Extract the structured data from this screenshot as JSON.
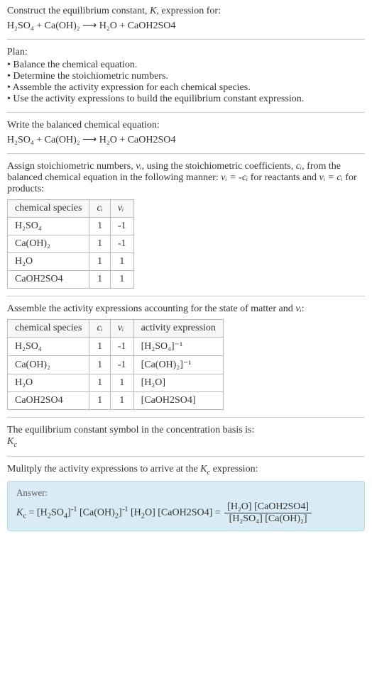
{
  "header": {
    "title_prefix": "Construct the equilibrium constant, ",
    "title_K": "K",
    "title_suffix": ", expression for:"
  },
  "eq1": "H₂SO₄ + Ca(OH)₂ ⟶ H₂O + CaOH2SO4",
  "plan": {
    "title": "Plan:",
    "items": [
      "Balance the chemical equation.",
      "Determine the stoichiometric numbers.",
      "Assemble the activity expression for each chemical species.",
      "Use the activity expressions to build the equilibrium constant expression."
    ]
  },
  "balanced": {
    "title": "Write the balanced chemical equation:",
    "eq": "H₂SO₄ + Ca(OH)₂ ⟶ H₂O + CaOH2SO4"
  },
  "assign": {
    "text_p1": "Assign stoichiometric numbers, ",
    "nu_i": "νᵢ",
    "text_p2": ", using the stoichiometric coefficients, ",
    "c_i": "cᵢ",
    "text_p3": ", from the balanced chemical equation in the following manner: ",
    "rel1": "νᵢ = -cᵢ",
    "text_p4": " for reactants and ",
    "rel2": "νᵢ = cᵢ",
    "text_p5": " for products:"
  },
  "table1": {
    "headers": [
      "chemical species",
      "cᵢ",
      "νᵢ"
    ],
    "rows": [
      {
        "species": "H₂SO₄",
        "c": "1",
        "nu": "-1"
      },
      {
        "species": "Ca(OH)₂",
        "c": "1",
        "nu": "-1"
      },
      {
        "species": "H₂O",
        "c": "1",
        "nu": "1"
      },
      {
        "species": "CaOH2SO4",
        "c": "1",
        "nu": "1"
      }
    ]
  },
  "assemble": {
    "text_p1": "Assemble the activity expressions accounting for the state of matter and ",
    "nu_i": "νᵢ",
    "text_p2": ":"
  },
  "table2": {
    "headers": [
      "chemical species",
      "cᵢ",
      "νᵢ",
      "activity expression"
    ],
    "rows": [
      {
        "species": "H₂SO₄",
        "c": "1",
        "nu": "-1",
        "act": "[H₂SO₄]⁻¹"
      },
      {
        "species": "Ca(OH)₂",
        "c": "1",
        "nu": "-1",
        "act": "[Ca(OH)₂]⁻¹"
      },
      {
        "species": "H₂O",
        "c": "1",
        "nu": "1",
        "act": "[H₂O]"
      },
      {
        "species": "CaOH2SO4",
        "c": "1",
        "nu": "1",
        "act": "[CaOH2SO4]"
      }
    ]
  },
  "kc_symbol": {
    "text": "The equilibrium constant symbol in the concentration basis is:",
    "symbol": "K_c"
  },
  "multiply": {
    "text_p1": "Mulitply the activity expressions to arrive at the ",
    "kc": "K_c",
    "text_p2": " expression:"
  },
  "answer": {
    "label": "Answer:",
    "lhs": "K_c = [H₂SO₄]⁻¹ [Ca(OH)₂]⁻¹ [H₂O] [CaOH2SO4] = ",
    "frac_num": "[H₂O] [CaOH2SO4]",
    "frac_den": "[H₂SO₄] [Ca(OH)₂]"
  },
  "chart_data": {
    "type": "table",
    "tables": [
      {
        "title": "stoichiometric numbers",
        "columns": [
          "chemical species",
          "c_i",
          "nu_i"
        ],
        "rows": [
          [
            "H2SO4",
            1,
            -1
          ],
          [
            "Ca(OH)2",
            1,
            -1
          ],
          [
            "H2O",
            1,
            1
          ],
          [
            "CaOH2SO4",
            1,
            1
          ]
        ]
      },
      {
        "title": "activity expressions",
        "columns": [
          "chemical species",
          "c_i",
          "nu_i",
          "activity expression"
        ],
        "rows": [
          [
            "H2SO4",
            1,
            -1,
            "[H2SO4]^-1"
          ],
          [
            "Ca(OH)2",
            1,
            -1,
            "[Ca(OH)2]^-1"
          ],
          [
            "H2O",
            1,
            1,
            "[H2O]"
          ],
          [
            "CaOH2SO4",
            1,
            1,
            "[CaOH2SO4]"
          ]
        ]
      }
    ]
  }
}
